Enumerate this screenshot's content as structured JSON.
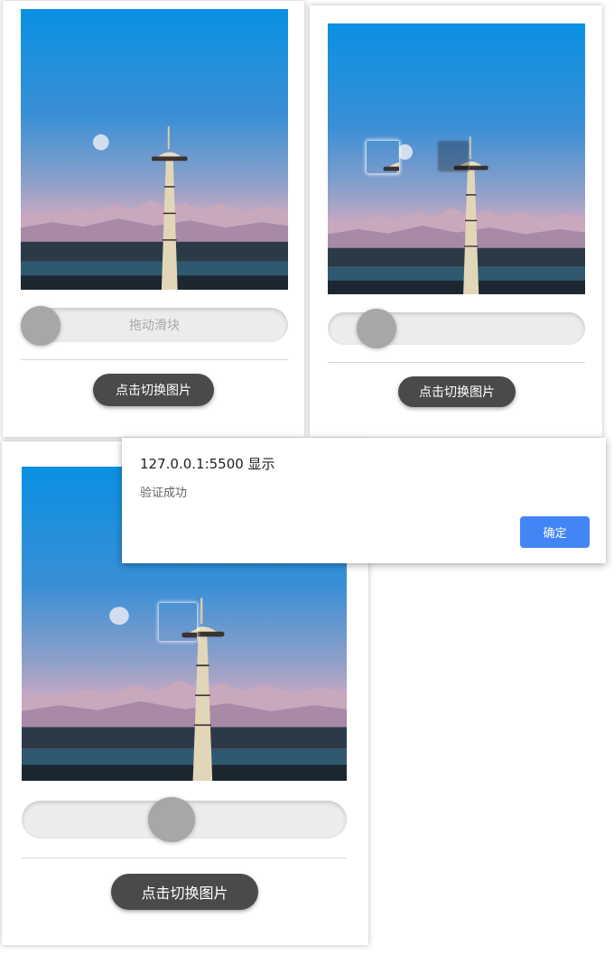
{
  "panels": [
    {
      "slider_label": "拖动滑块",
      "switch_label": "点击切换图片"
    },
    {
      "slider_label": "",
      "switch_label": "点击切换图片"
    },
    {
      "slider_label": "",
      "switch_label": "点击切换图片"
    }
  ],
  "dialog": {
    "title": "127.0.0.1:5500 显示",
    "message": "验证成功",
    "ok_label": "确定"
  }
}
